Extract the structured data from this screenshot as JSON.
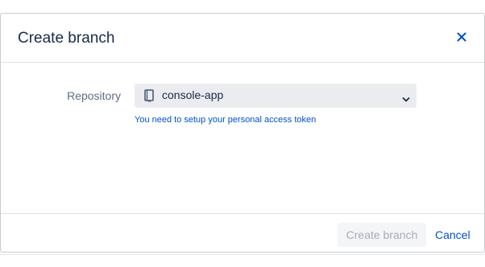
{
  "dialog": {
    "title": "Create branch",
    "close_icon": "close-icon",
    "accent_color": "#0052cc"
  },
  "form": {
    "repository_label": "Repository",
    "repository_value": "console-app",
    "repository_icon": "repository-icon",
    "token_message": "You need to setup your personal access token"
  },
  "footer": {
    "create_label": "Create branch",
    "cancel_label": "Cancel"
  }
}
